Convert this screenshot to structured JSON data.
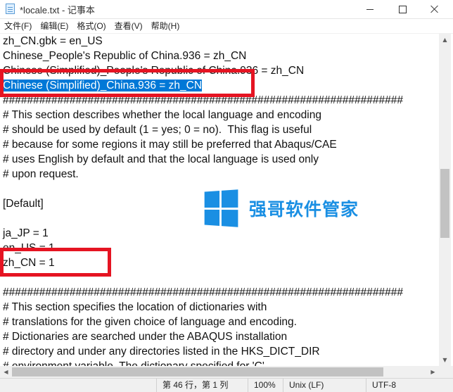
{
  "window": {
    "title": "*locale.txt - 记事本",
    "icon": "notepad-icon"
  },
  "menu": [
    "文件(F)",
    "编辑(E)",
    "格式(O)",
    "查看(V)",
    "帮助(H)"
  ],
  "editor": {
    "lines": [
      "zh_CN.gbk = en_US",
      "Chinese_People's Republic of China.936 = zh_CN",
      "Chinese (Simplified)_People's Republic of China.936 = zh_CN",
      "Chinese (Simplified)_China.936 = zh_CN",
      "##################################################################",
      "# This section describes whether the local language and encoding",
      "# should be used by default (1 = yes; 0 = no).  This flag is useful",
      "# because for some regions it may still be preferred that Abaqus/CAE",
      "# uses English by default and that the local language is used only",
      "# upon request.",
      "",
      "[Default]",
      "",
      "ja_JP = 1",
      "en_US = 1",
      "zh_CN = 1",
      "",
      "##################################################################",
      "# This section specifies the location of dictionaries with",
      "# translations for the given choice of language and encoding.",
      "# Dictionaries are searched under the ABAQUS installation",
      "# directory and under any directories listed in the HKS_DICT_DIR",
      "# environment variable. The dictionary specified for 'C'"
    ],
    "selected_line_index": 3,
    "highlight_color": "#e51422",
    "selection_color": "#0078d7"
  },
  "watermark": {
    "text": "强哥软件管家",
    "color": "#1a8fe3"
  },
  "status": {
    "position": "第 46 行，第 1 列",
    "zoom": "100%",
    "line_ending": "Unix (LF)",
    "encoding": "UTF-8"
  }
}
